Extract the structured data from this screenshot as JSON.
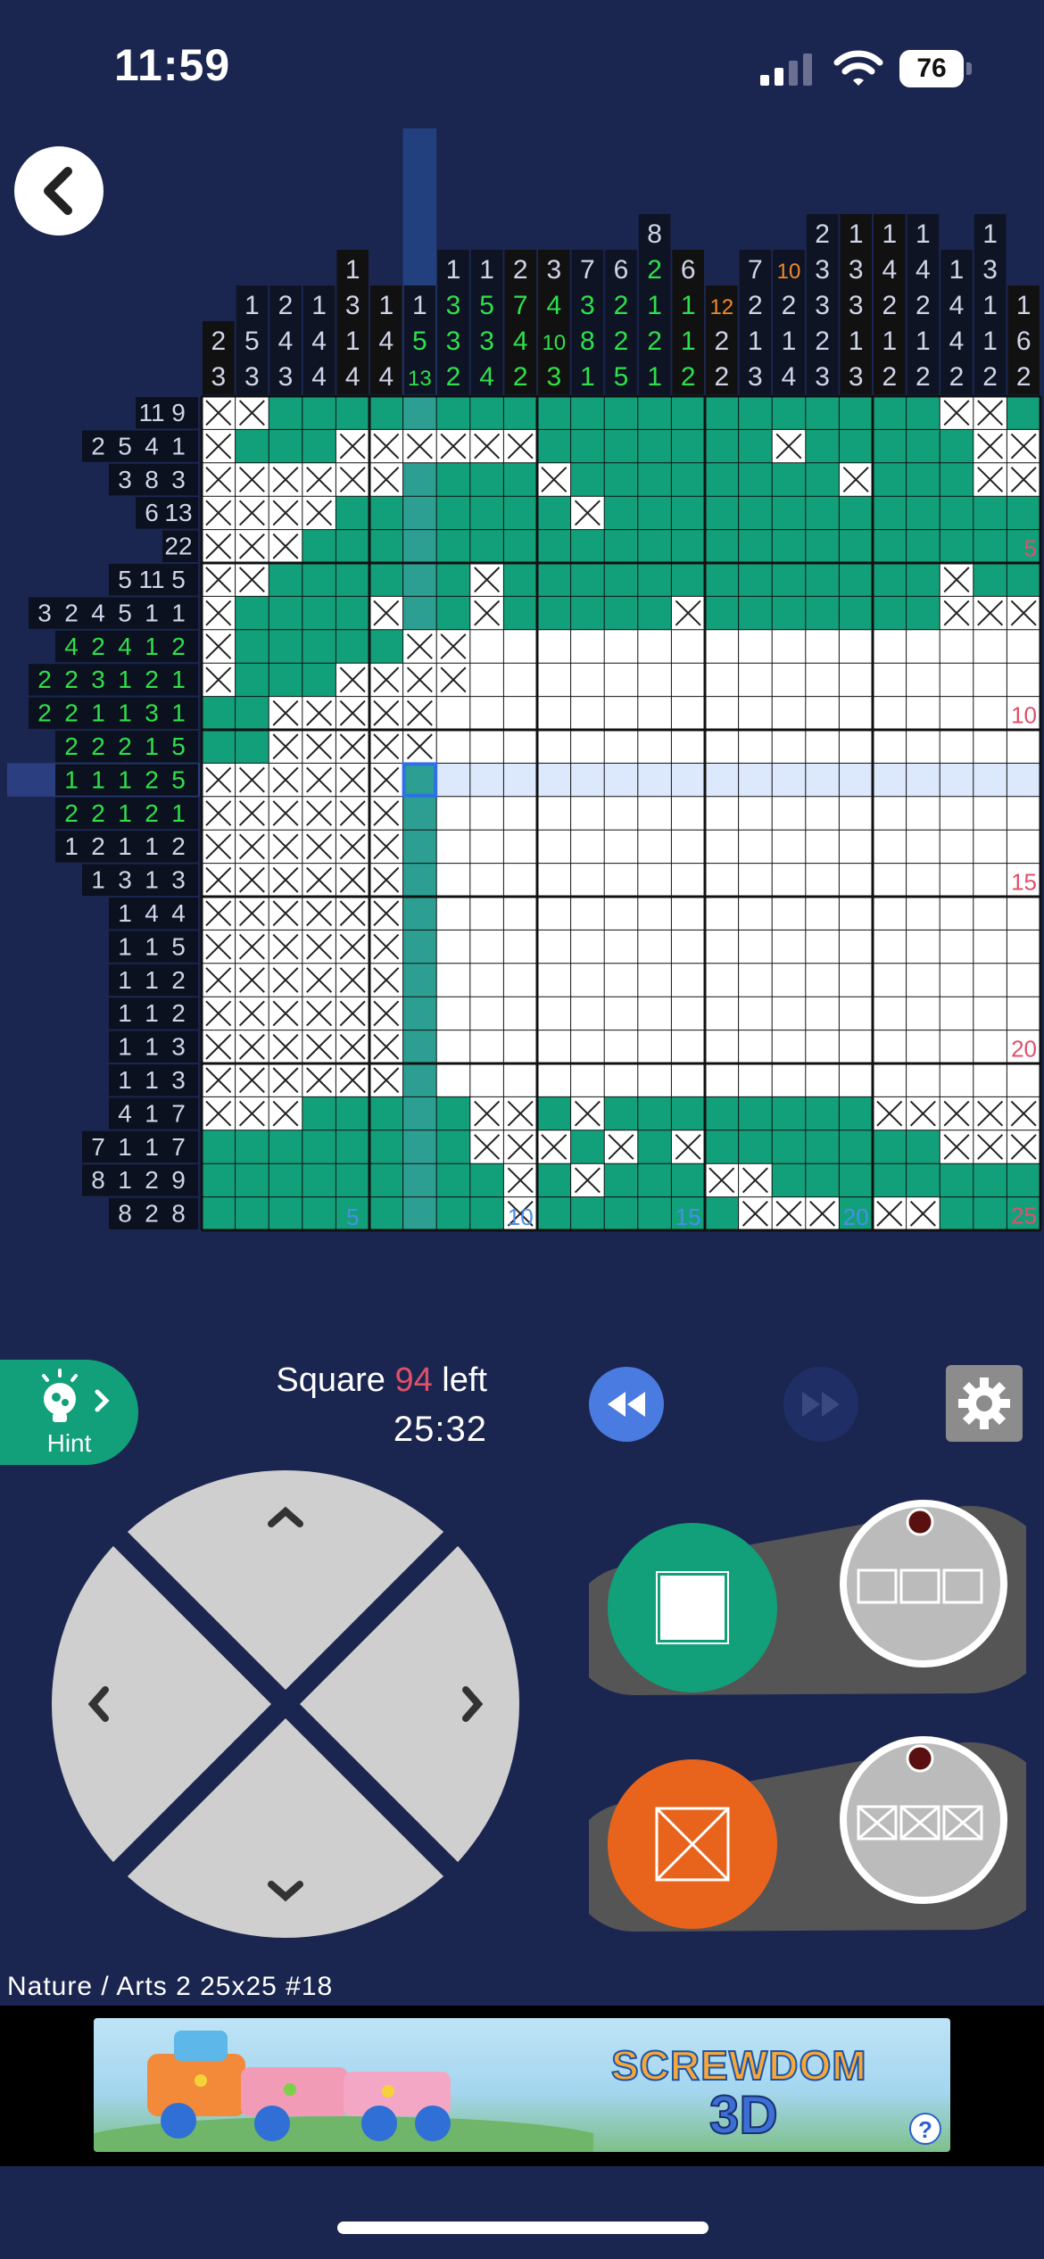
{
  "status_bar": {
    "time": "11:59",
    "battery": "76"
  },
  "game": {
    "grid_size": 25,
    "selected_cell": {
      "row": 12,
      "col": 7
    },
    "col_clues": [
      [
        2,
        3
      ],
      [
        1,
        5,
        3
      ],
      [
        2,
        4,
        3
      ],
      [
        1,
        4,
        4
      ],
      [
        1,
        3,
        1,
        4
      ],
      [
        1,
        4,
        4
      ],
      [
        1,
        5,
        13
      ],
      [
        1,
        3,
        3,
        2
      ],
      [
        1,
        5,
        3,
        4
      ],
      [
        2,
        7,
        4,
        2
      ],
      [
        3,
        4,
        10,
        3
      ],
      [
        7,
        3,
        8,
        1
      ],
      [
        6,
        2,
        2,
        5
      ],
      [
        8,
        2,
        1,
        2,
        1
      ],
      [
        6,
        1,
        1,
        2
      ],
      [
        12,
        2,
        2
      ],
      [
        7,
        2,
        1,
        3
      ],
      [
        10,
        2,
        1,
        4
      ],
      [
        2,
        3,
        3,
        2,
        3
      ],
      [
        1,
        3,
        3,
        1,
        3
      ],
      [
        1,
        4,
        2,
        1,
        2
      ],
      [
        1,
        4,
        2,
        1,
        2
      ],
      [
        1,
        4,
        4,
        2
      ],
      [
        1,
        3,
        1,
        1,
        2
      ],
      [
        1,
        6,
        2
      ]
    ],
    "row_clues": [
      [
        11,
        9
      ],
      [
        2,
        5,
        4,
        1
      ],
      [
        3,
        8,
        3
      ],
      [
        6,
        13
      ],
      [
        22
      ],
      [
        5,
        11,
        5
      ],
      [
        3,
        2,
        4,
        5,
        1,
        1
      ],
      [
        4,
        2,
        4,
        1,
        2
      ],
      [
        2,
        2,
        3,
        1,
        2,
        1
      ],
      [
        2,
        2,
        1,
        1,
        3,
        1
      ],
      [
        2,
        2,
        2,
        1,
        5
      ],
      [
        1,
        1,
        1,
        2,
        5
      ],
      [
        2,
        2,
        1,
        2,
        1
      ],
      [
        1,
        2,
        1,
        1,
        2
      ],
      [
        1,
        3,
        1,
        3
      ],
      [
        1,
        4,
        4
      ],
      [
        1,
        1,
        5
      ],
      [
        1,
        1,
        2
      ],
      [
        1,
        1,
        2
      ],
      [
        1,
        1,
        3
      ],
      [
        1,
        1,
        3
      ],
      [
        4,
        1,
        7
      ],
      [
        7,
        1,
        1,
        7
      ],
      [
        8,
        1,
        2,
        9
      ],
      [
        8,
        2,
        8
      ]
    ],
    "grid_rows": [
      "XX....................XX.X",
      "X...XXXXXX.......X.....XXXXXX.",
      "XXXXXX....X........X...XX.X",
      "XXXX.......X...............X",
      "XXX......................",
      "XX......X.............X....",
      "X....X..X.....X.......XXXX..X.",
      "X.....XX__________________",
      "X...XXXX__________________",
      "..XXXXX__________________",
      "..XXXXX__________________",
      "XXXXXXX__________________",
      "XXXXXX.__________________",
      "XXXXXX.__________________",
      "XXXXXX.__________________",
      "XXXXXX.__________________",
      "XXXXXX.__________________",
      "XXXXXX.__________________",
      "XXXXXX.__________________",
      "XXXXXX.__________________",
      "XXXXXX.__________________",
      "XXX.....XX.X........XXXXXXX",
      "........XXX.X.X.......XXXX",
      ".........X.X...XX.........",
      ".........X......XXX.XX....."
    ],
    "row_markers": {
      "5": "5",
      "10": "10",
      "15": "15",
      "20": "20",
      "25": "25"
    },
    "col_markers": {
      "5": "5",
      "10": "10",
      "15": "15",
      "20": "20"
    }
  },
  "controls": {
    "hint_label": "Hint",
    "squares_prefix": "Square",
    "squares_left_count": "94",
    "squares_suffix": "left",
    "timer": "25:32"
  },
  "footer": {
    "puzzle_info": "Nature / Arts 2  25x25  #18"
  },
  "ad": {
    "title": "SCREWDOM",
    "subtitle": "3D",
    "info": "?"
  },
  "colors": {
    "background": "#1b2650",
    "filled": "#12a07a",
    "highlight_column": "#2d9e92",
    "selected_row": "#dce8fb",
    "cross_button": "#e8641c",
    "undo": "#4a7be0",
    "marker_red": "#e0506a",
    "marker_blue": "#4a8ee8"
  }
}
